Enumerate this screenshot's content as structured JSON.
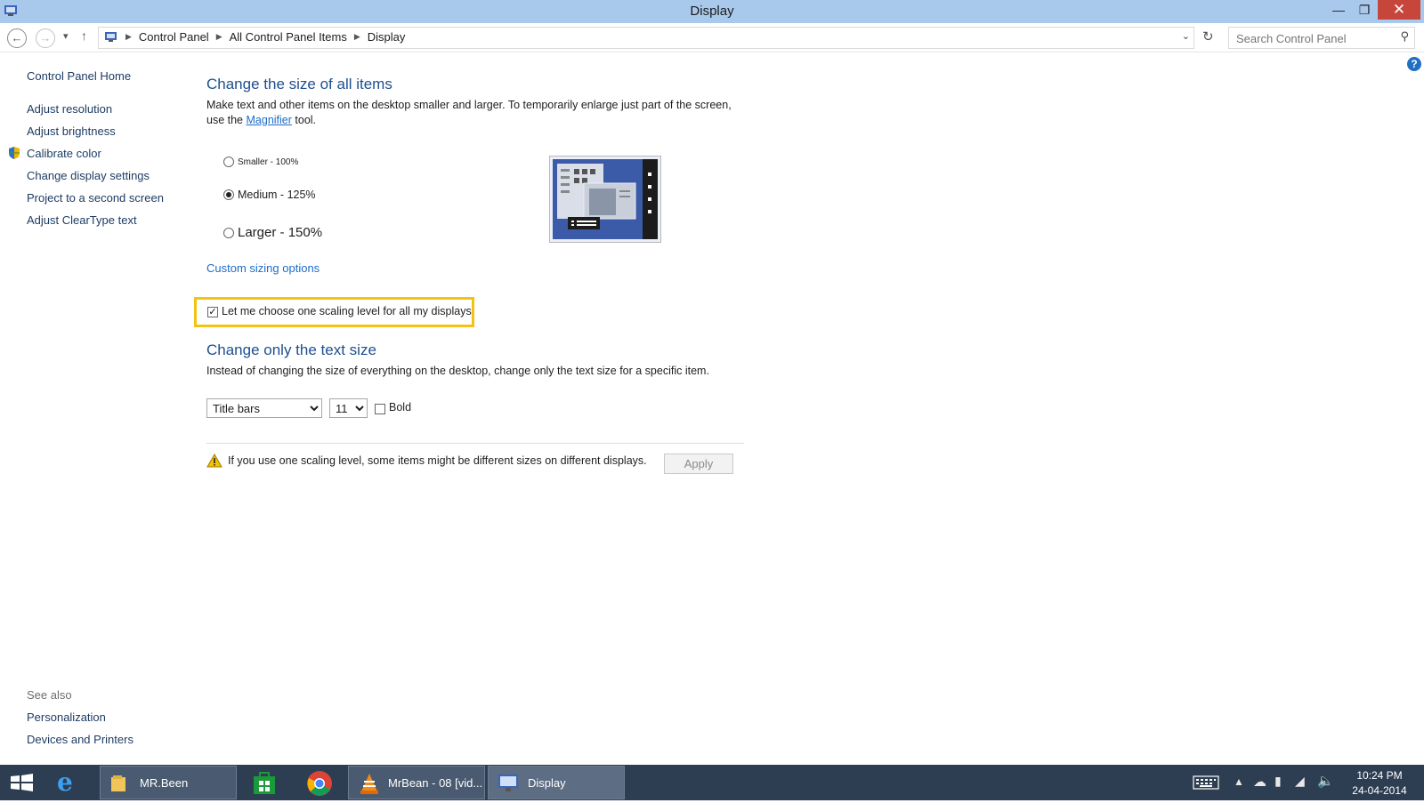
{
  "window": {
    "title": "Display"
  },
  "address": {
    "crumbs": [
      "Control Panel",
      "All Control Panel Items",
      "Display"
    ],
    "search_placeholder": "Search Control Panel"
  },
  "sidebar": {
    "items": [
      "Control Panel Home",
      "Adjust resolution",
      "Adjust brightness",
      "Calibrate color",
      "Change display settings",
      "Project to a second screen",
      "Adjust ClearType text"
    ],
    "see_also": "See also",
    "see_also_items": [
      "Personalization",
      "Devices and Printers"
    ]
  },
  "main": {
    "section1_title": "Change the size of all items",
    "section1_desc_a": "Make text and other items on the desktop smaller and larger. To temporarily enlarge just part of the screen,",
    "section1_desc_b_pre": "use the",
    "section1_desc_link": "Magnifier",
    "section1_desc_b_post": "tool.",
    "options": [
      {
        "label": "Smaller - 100%",
        "selected": false
      },
      {
        "label": "Medium - 125%",
        "selected": true
      },
      {
        "label": "Larger - 150%",
        "selected": false
      }
    ],
    "custom_sizing": "Custom sizing options",
    "scaling_checkbox_label": "Let me choose one scaling level for all my displays",
    "scaling_checked": true,
    "section2_title": "Change only the text size",
    "section2_desc": "Instead of changing the size of everything on the desktop, change only the text size for a specific item.",
    "item_select": "Title bars",
    "size_select": "11",
    "bold_label": "Bold",
    "warning_text": "If you use one scaling level, some items might be different sizes on different displays.",
    "apply_label": "Apply"
  },
  "taskbar": {
    "items": [
      "MR.Been",
      "MrBean - 08 [vid...",
      "Display"
    ],
    "time": "10:24 PM",
    "date": "24-04-2014"
  },
  "colors": {
    "titlebar": "#a9c9ec",
    "heading": "#1e4f8f",
    "highlight": "#f2c314",
    "taskbar": "#2d3d52"
  }
}
